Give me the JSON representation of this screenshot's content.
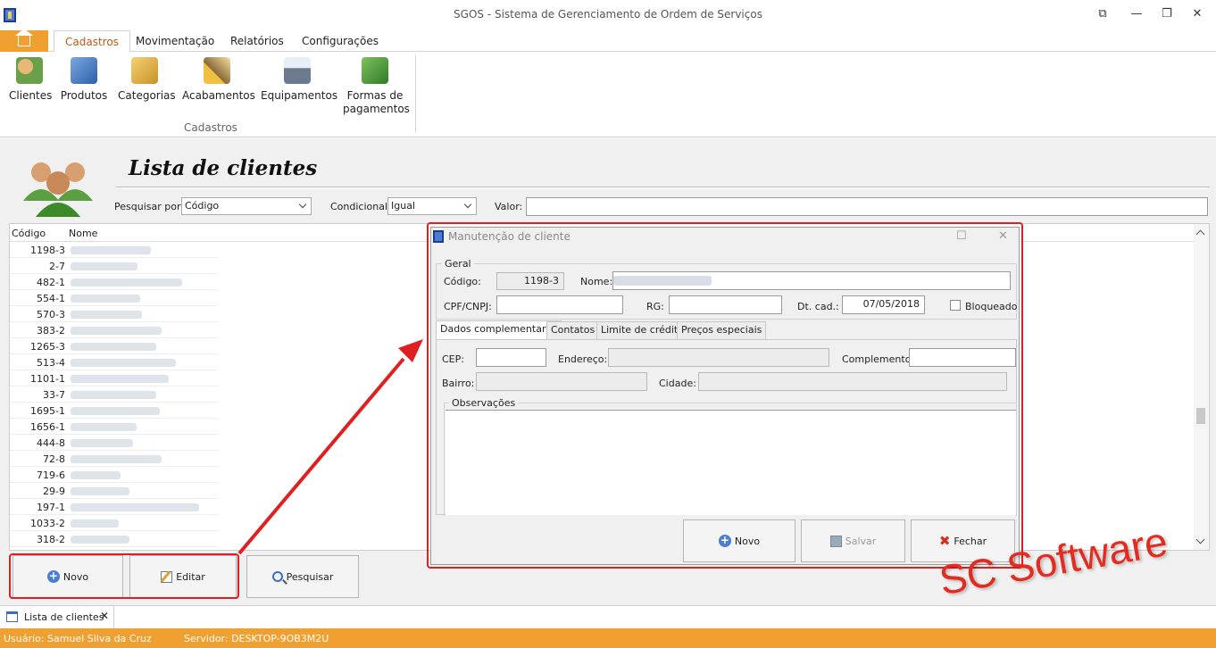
{
  "window": {
    "title": "SGOS - Sistema de Gerenciamento de Ordem de Serviços"
  },
  "ribbon": {
    "tabs": [
      "Cadastros",
      "Movimentação",
      "Relatórios",
      "Configurações"
    ],
    "buttons": [
      "Clientes",
      "Produtos",
      "Categorias",
      "Acabamentos",
      "Equipamentos",
      "Formas de pagamentos"
    ],
    "group_label": "Cadastros"
  },
  "list": {
    "title": "Lista de clientes",
    "search_by_label": "Pesquisar por:",
    "search_by_value": "Código",
    "condition_label": "Condicional:",
    "condition_value": "Igual",
    "value_label": "Valor:",
    "value_input": "",
    "columns": [
      "Código",
      "Nome"
    ],
    "rows": [
      "1198-3",
      "2-7",
      "482-1",
      "554-1",
      "570-3",
      "383-2",
      "1265-3",
      "513-4",
      "1101-1",
      "33-7",
      "1695-1",
      "1656-1",
      "444-8",
      "72-8",
      "719-6",
      "29-9",
      "197-1",
      "1033-2",
      "318-2"
    ],
    "buttons": {
      "novo": "Novo",
      "editar": "Editar",
      "pesquisar": "Pesquisar"
    }
  },
  "dialog": {
    "title": "Manutenção de cliente",
    "group_label": "Geral",
    "codigo_label": "Código:",
    "codigo_value": "1198-3",
    "nome_label": "Nome:",
    "cpf_label": "CPF/CNPJ:",
    "rg_label": "RG:",
    "dtcad_label": "Dt. cad.:",
    "dtcad_value": "07/05/2018",
    "bloqueado_label": "Bloqueado",
    "tabs": [
      "Dados complementares",
      "Contatos",
      "Limite de crédito",
      "Preços especiais"
    ],
    "cep_label": "CEP:",
    "endereco_label": "Endereço:",
    "complemento_label": "Complemento:",
    "bairro_label": "Bairro:",
    "cidade_label": "Cidade:",
    "observacoes_label": "Observações",
    "buttons": {
      "novo": "Novo",
      "salvar": "Salvar",
      "fechar": "Fechar"
    }
  },
  "doc_tab": {
    "label": "Lista de clientes"
  },
  "status": {
    "user": "Usuário: Samuel Silva da Cruz",
    "server": "Servidor: DESKTOP-9OB3M2U"
  },
  "watermark": "SC Software",
  "colors": {
    "accent": "#f0a030",
    "highlight": "#e02020"
  }
}
